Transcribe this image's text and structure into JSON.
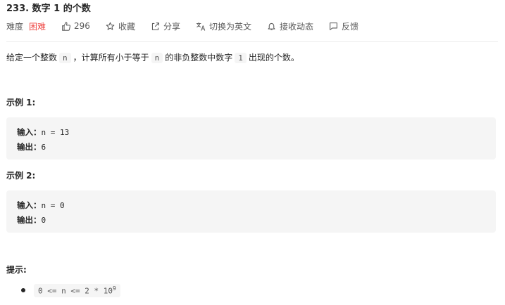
{
  "problem": {
    "title": "233. 数字 1 的个数"
  },
  "meta": {
    "difficulty_label": "难度",
    "difficulty_value": "困难",
    "likes": "296",
    "favorite_label": "收藏",
    "share_label": "分享",
    "translate_label": "切换为英文",
    "subscribe_label": "接收动态",
    "feedback_label": "反馈"
  },
  "description": {
    "part1": "给定一个整数",
    "code1": "n",
    "part2": "，计算所有小于等于",
    "code2": "n",
    "part3": "的非负整数中数字",
    "code3": "1",
    "part4": "出现的个数。"
  },
  "examples": [
    {
      "title": "示例 1:",
      "input_label": "输入：",
      "input_value": "n = 13",
      "output_label": "输出：",
      "output_value": "6"
    },
    {
      "title": "示例 2:",
      "input_label": "输入：",
      "input_value": "n = 0",
      "output_label": "输出：",
      "output_value": "0"
    }
  ],
  "hints": {
    "title": "提示:",
    "constraint_text": "0 <= n <= 2 * 10",
    "constraint_exp": "9"
  },
  "colors": {
    "hard": "#ef4743",
    "text": "#262626",
    "muted": "#595959",
    "code_bg": "#f5f5f5"
  }
}
